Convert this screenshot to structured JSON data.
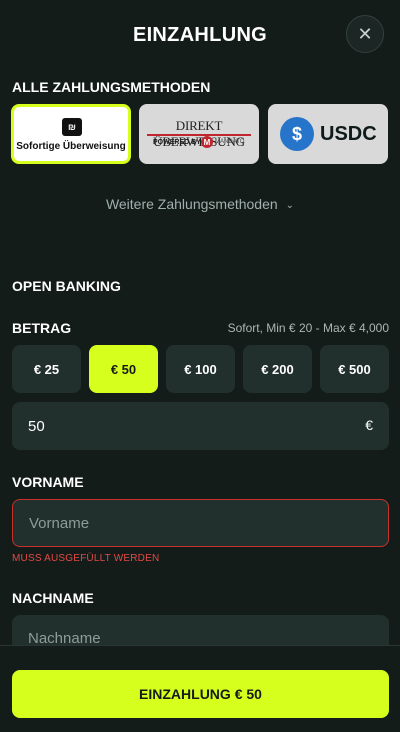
{
  "header": {
    "title": "EINZAHLUNG",
    "close_icon": "close-icon",
    "close_glyph": "✕"
  },
  "payment_methods": {
    "section_label": "ALLE ZAHLUNGSMETHODEN",
    "items": [
      {
        "name": "Sofortige Überweisung",
        "logo_text": "Sofortige Überweisung",
        "selected": true
      },
      {
        "name": "Direkt Überweisung",
        "logo_line1": "DIREKT ÜBERWEISUNG",
        "logo_line2": "POWERED BY",
        "logo_brand": "MANDATO",
        "selected": false
      },
      {
        "name": "USDC",
        "logo_text": "USDC",
        "icon_glyph": "$",
        "selected": false
      }
    ],
    "more_label": "Weitere Zahlungsmethoden",
    "more_icon": "chevron-down-icon",
    "more_glyph": "⌄"
  },
  "open_banking": {
    "label": "OPEN BANKING"
  },
  "amount": {
    "label": "BETRAG",
    "limits_text": "Sofort, Min € 20 - Max € 4,000",
    "presets": [
      "€ 25",
      "€ 50",
      "€ 100",
      "€ 200",
      "€ 500"
    ],
    "selected_index": 1,
    "value": "50",
    "currency": "€"
  },
  "form": {
    "first_name": {
      "label": "VORNAME",
      "placeholder": "Vorname",
      "value": "",
      "error": "MUSS AUSGEFÜLLT WERDEN"
    },
    "last_name": {
      "label": "NACHNAME",
      "placeholder": "Nachname",
      "value": ""
    }
  },
  "submit": {
    "label": "EINZAHLUNG € 50"
  },
  "colors": {
    "background": "#141c1a",
    "surface": "#21302d",
    "accent": "#d7ff1e",
    "error": "#c9302c",
    "usdc_blue": "#2775ca"
  }
}
